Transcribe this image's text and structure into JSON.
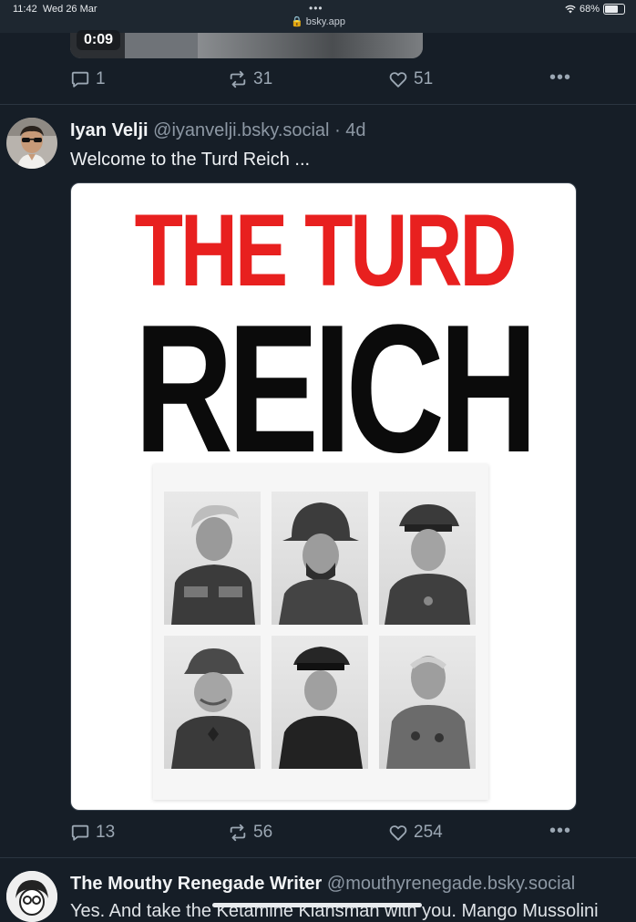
{
  "status_bar": {
    "time": "11:42",
    "date": "Wed 26 Mar",
    "url": "bsky.app",
    "battery": "68%",
    "battery_level": 0.68
  },
  "previous_post": {
    "video_duration": "0:09",
    "replies": "1",
    "reposts": "31",
    "likes": "51"
  },
  "post": {
    "author_name": "Iyan Velji",
    "author_handle": "@iyanvelji.bsky.social",
    "time_ago": "· 4d",
    "text": "Welcome to the Turd Reich ...",
    "image": {
      "title_line1": "THE TURD",
      "title_line2": "REICH",
      "title_line1_color": "#e8201f",
      "title_line2_color": "#0b0b0b"
    },
    "replies": "13",
    "reposts": "56",
    "likes": "254"
  },
  "next_post": {
    "author_name": "The Mouthy Renegade Writer",
    "author_handle": "@mouthyrenegade.bsky.social",
    "text": "Yes. And take the Ketamine Klansman with you. Mango Mussolini"
  },
  "icons": {
    "reply": "reply-icon",
    "repost": "repost-icon",
    "like": "heart-icon",
    "more": "more-options-icon"
  }
}
